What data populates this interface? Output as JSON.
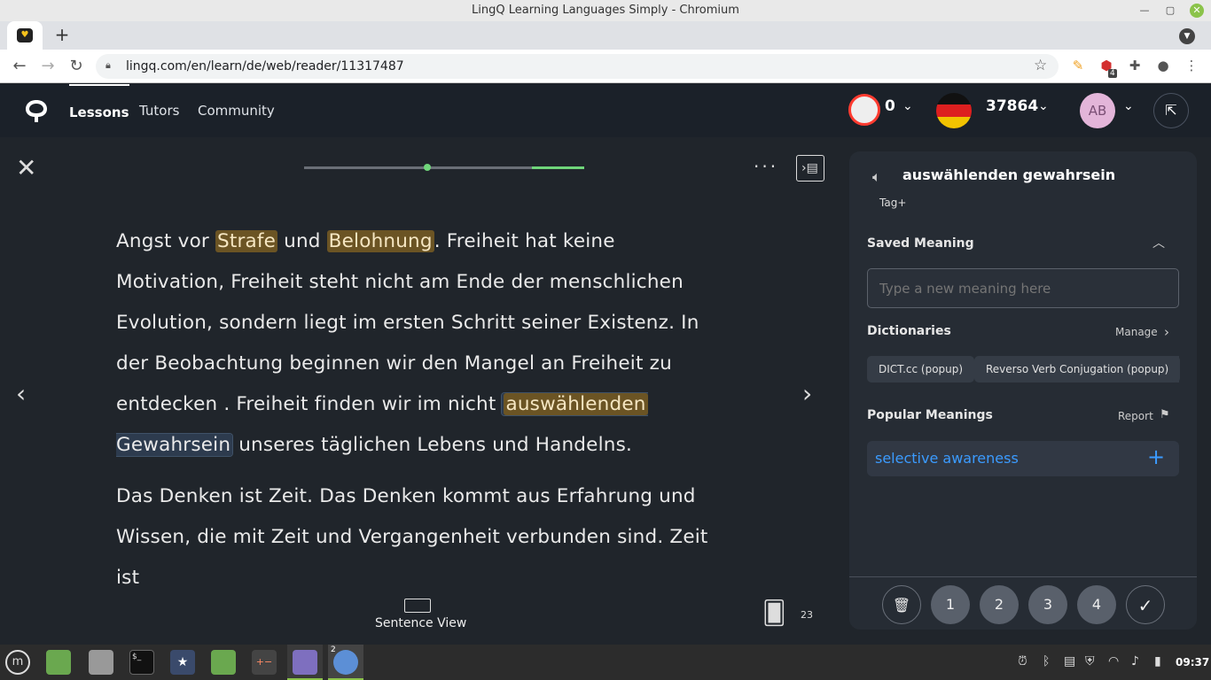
{
  "window": {
    "title": "LingQ Learning Languages Simply - Chromium"
  },
  "browser": {
    "url": "lingq.com/en/learn/de/web/reader/11317487",
    "ext_badge": "4"
  },
  "header": {
    "nav": [
      "Lessons",
      "Tutors",
      "Community"
    ],
    "streak": "0",
    "coins": "37864",
    "avatar_initials": "AB"
  },
  "reader": {
    "paragraph1": {
      "t1": "Angst vor ",
      "w1": "Strafe",
      "t2": " und ",
      "w2": "Belohnung",
      "t3": ". Freiheit hat keine Motivation, Freiheit steht nicht am Ende der menschlichen Evolution, sondern liegt im ersten Schritt seiner Existenz. In der Beobachtung beginnen wir den Mangel an Freiheit zu entdecken . Freiheit finden wir im nicht ",
      "sel1": "auswählenden",
      "sel2": "Gewahrsein",
      "t4": " unseres täglichen Lebens und Handelns."
    },
    "paragraph2": "Das Denken ist Zeit. Das Denken kommt aus Erfahrung und Wissen, die mit Zeit und Vergangenheit verbunden sind. Zeit ist",
    "sentence_view_label": "Sentence View",
    "cards_count": "23",
    "progress_fraction": 0.44
  },
  "panel": {
    "term": "auswählenden gewahrsein",
    "tag_label": "Tag+",
    "saved_meaning_title": "Saved Meaning",
    "meaning_placeholder": "Type a new meaning here",
    "dictionaries_title": "Dictionaries",
    "manage_label": "Manage",
    "dictionaries": [
      "DICT.cc (popup)",
      "Reverso Verb Conjugation (popup)"
    ],
    "popular_title": "Popular Meanings",
    "report_label": "Report",
    "popular_meaning": "selective awareness",
    "status_buttons": [
      "1",
      "2",
      "3",
      "4"
    ]
  },
  "taskbar": {
    "clock": "09:37",
    "workspace_badge": "2"
  },
  "colors": {
    "lingq_highlight": "#6b5424",
    "accent_blue": "#3b9bff",
    "progress_green": "#6fd67a"
  }
}
